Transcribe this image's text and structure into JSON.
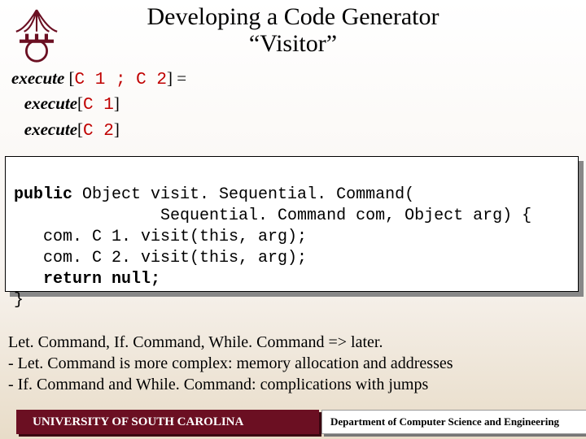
{
  "title_line1": "Developing a Code Generator",
  "title_line2": "“Visitor”",
  "spec": {
    "l1_a": "execute",
    "l1_b": " [",
    "l1_c": "C 1 ; C 2",
    "l1_d": "] =",
    "l2_a": "execute",
    "l2_b": "[",
    "l2_c": "C 1",
    "l2_d": "]",
    "l3_a": "execute",
    "l3_b": "[",
    "l3_c": "C 2",
    "l3_d": "]"
  },
  "code": {
    "l1a": "public",
    "l1b": " Object visit. Sequential. Command(",
    "l2": "               Sequential. Command com, Object arg) {",
    "l3": "   com. C 1. visit(this, arg);",
    "l4": "   com. C 2. visit(this, arg);",
    "l5a": "   ",
    "l5b": "return null;",
    "l6": "}"
  },
  "notes": {
    "l1": "Let. Command, If. Command, While. Command => later.",
    "l2": " - Let. Command is more complex: memory allocation and addresses",
    "l3": " - If. Command and While. Command: complications with jumps"
  },
  "footer": {
    "left": "UNIVERSITY OF SOUTH CAROLINA",
    "right": "Department of Computer Science and Engineering"
  }
}
